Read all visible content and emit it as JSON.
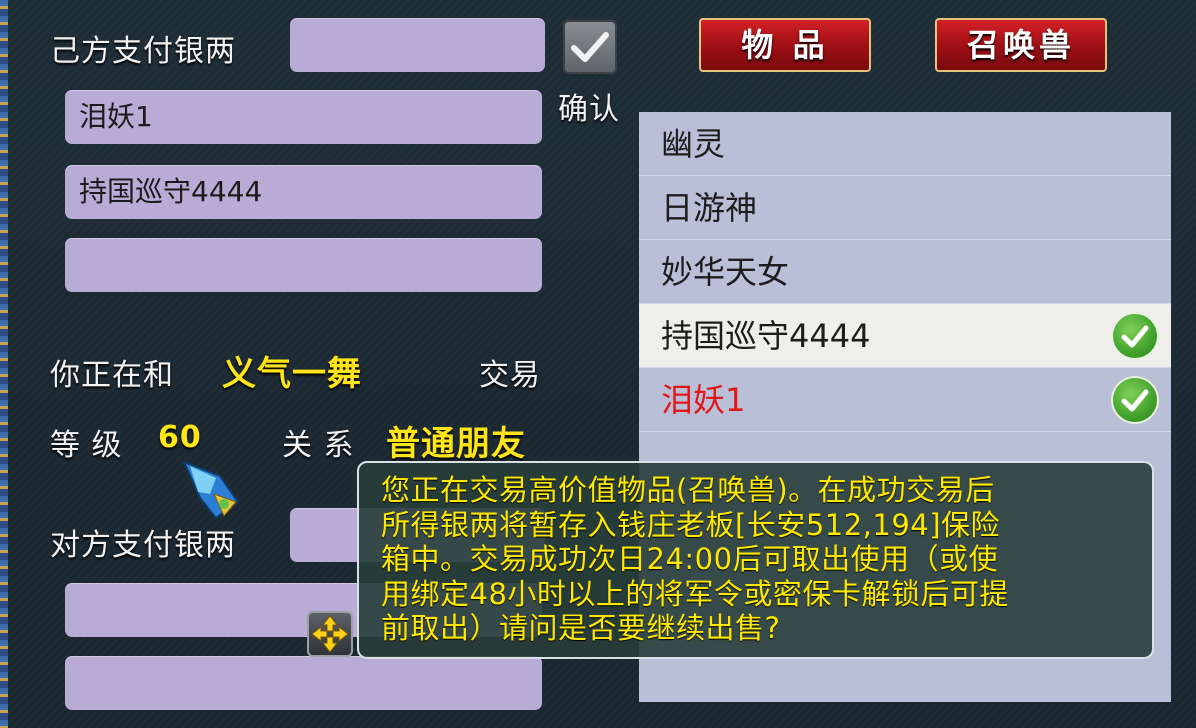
{
  "self_pay": {
    "label": "己方支付银两",
    "value": ""
  },
  "confirm": {
    "label": "确认",
    "checked": true
  },
  "tabs": {
    "items_label": "物 品",
    "pets_label": "召唤兽"
  },
  "self_slots": [
    "泪妖1",
    "持国巡守4444",
    ""
  ],
  "trade_info": {
    "trading_with_prefix": "你正在和",
    "partner_name": "义气一舞",
    "trading_with_suffix": "交易",
    "level_label": "等 级",
    "level_value": "60",
    "relation_label": "关 系",
    "relation_value": "普通朋友"
  },
  "other_pay": {
    "label": "对方支付银两",
    "value": ""
  },
  "other_slots": [
    "",
    ""
  ],
  "pet_list": [
    {
      "name": "幽灵",
      "selected": false,
      "checked": false,
      "color": "#1d1d1d"
    },
    {
      "name": "日游神",
      "selected": false,
      "checked": false,
      "color": "#1d1d1d"
    },
    {
      "name": "妙华天女",
      "selected": false,
      "checked": false,
      "color": "#1d1d1d"
    },
    {
      "name": "持国巡守4444",
      "selected": true,
      "checked": true,
      "color": "#1d1d1d"
    },
    {
      "name": "泪妖1",
      "selected": false,
      "checked": true,
      "color": "#e01818"
    }
  ],
  "dialog": {
    "lines": [
      "您正在交易高价值物品(召唤兽)。在成功交易后",
      "所得银两将暂存入钱庄老板[长安512,194]保险",
      "箱中。交易成功次日24:00后可取出使用（或使",
      "用绑定48小时以上的将军令或密保卡解锁后可提",
      "前取出）请问是否要继续出售?"
    ]
  },
  "icons": {
    "checkbox": "checkmark-icon",
    "move": "move-arrows-icon",
    "cursor": "gem-cursor-icon",
    "ok": "green-check-icon"
  },
  "colors": {
    "accent_yellow": "#ffe418",
    "button_red": "#b3151b",
    "field_lavender": "#b8acd6",
    "dialog_text": "#ffe800"
  }
}
